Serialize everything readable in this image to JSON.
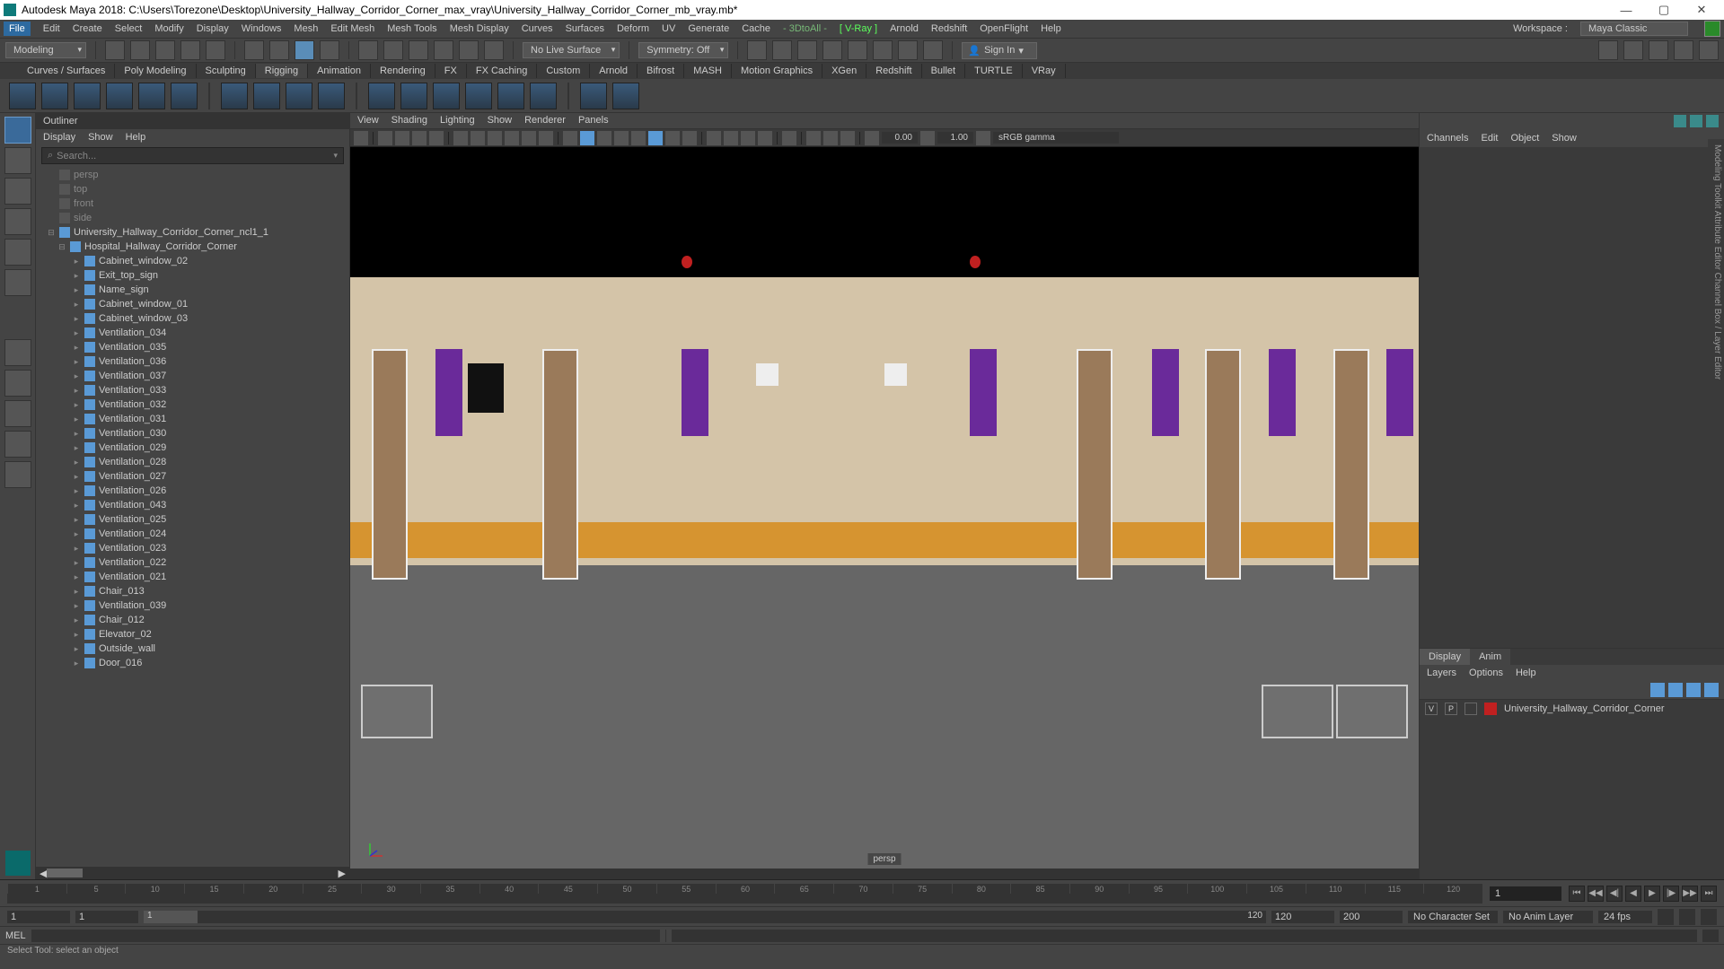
{
  "titlebar": {
    "title": "Autodesk Maya 2018: C:\\Users\\Torezone\\Desktop\\University_Hallway_Corridor_Corner_max_vray\\University_Hallway_Corridor_Corner_mb_vray.mb*"
  },
  "menubar": {
    "items": [
      "File",
      "Edit",
      "Create",
      "Select",
      "Modify",
      "Display",
      "Windows",
      "Mesh",
      "Edit Mesh",
      "Mesh Tools",
      "Mesh Display",
      "Curves",
      "Surfaces",
      "Deform",
      "UV",
      "Generate",
      "Cache"
    ],
    "plugins": {
      "p1": "- 3DtoAll -",
      "vray": "[ V-Ray ]",
      "arnold": "Arnold",
      "redshift": "Redshift",
      "openflight": "OpenFlight",
      "help": "Help"
    },
    "workspace_label": "Workspace :",
    "workspace_value": "Maya Classic"
  },
  "toolshelf": {
    "mode": "Modeling",
    "liveSurface": "No Live Surface",
    "symmetry": "Symmetry: Off",
    "signin": "Sign In"
  },
  "shelfTabs": [
    "Curves / Surfaces",
    "Poly Modeling",
    "Sculpting",
    "Rigging",
    "Animation",
    "Rendering",
    "FX",
    "FX Caching",
    "Custom",
    "Arnold",
    "Bifrost",
    "MASH",
    "Motion Graphics",
    "XGen",
    "Redshift",
    "Bullet",
    "TURTLE",
    "VRay"
  ],
  "shelfActive": "Rigging",
  "outliner": {
    "title": "Outliner",
    "menus": [
      "Display",
      "Show",
      "Help"
    ],
    "search_placeholder": "Search...",
    "cameras": [
      "persp",
      "top",
      "front",
      "side"
    ],
    "root": "University_Hallway_Corridor_Corner_ncl1_1",
    "group": "Hospital_Hallway_Corridor_Corner",
    "items": [
      "Cabinet_window_02",
      "Exit_top_sign",
      "Name_sign",
      "Cabinet_window_01",
      "Cabinet_window_03",
      "Ventilation_034",
      "Ventilation_035",
      "Ventilation_036",
      "Ventilation_037",
      "Ventilation_033",
      "Ventilation_032",
      "Ventilation_031",
      "Ventilation_030",
      "Ventilation_029",
      "Ventilation_028",
      "Ventilation_027",
      "Ventilation_026",
      "Ventilation_043",
      "Ventilation_025",
      "Ventilation_024",
      "Ventilation_023",
      "Ventilation_022",
      "Ventilation_021",
      "Chair_013",
      "Ventilation_039",
      "Chair_012",
      "Elevator_02",
      "Outside_wall",
      "Door_016"
    ]
  },
  "viewport": {
    "menus": [
      "View",
      "Shading",
      "Lighting",
      "Show",
      "Renderer",
      "Panels"
    ],
    "exposure": "0.00",
    "gamma": "1.00",
    "colorspace": "sRGB gamma",
    "label": "persp"
  },
  "channelbox": {
    "menus": [
      "Channels",
      "Edit",
      "Object",
      "Show"
    ],
    "layerTabs": {
      "display": "Display",
      "anim": "Anim"
    },
    "layerMenus": [
      "Layers",
      "Options",
      "Help"
    ],
    "layerV": "V",
    "layerP": "P",
    "layerName": "University_Hallway_Corridor_Corner"
  },
  "timeline": {
    "current": "1",
    "ticks": [
      "1",
      "5",
      "10",
      "15",
      "20",
      "25",
      "30",
      "35",
      "40",
      "45",
      "50",
      "55",
      "60",
      "65",
      "70",
      "75",
      "80",
      "85",
      "90",
      "95",
      "100",
      "105",
      "110",
      "115",
      "120"
    ],
    "start": "1",
    "startRange": "1",
    "end": "120",
    "endRange": "200",
    "charset": "No Character Set",
    "animlayer": "No Anim Layer",
    "fps": "24 fps",
    "sliderLabel": "1",
    "sliderEnd": "120"
  },
  "cmdline": {
    "label": "MEL"
  },
  "status": {
    "text": "Select Tool: select an object"
  }
}
